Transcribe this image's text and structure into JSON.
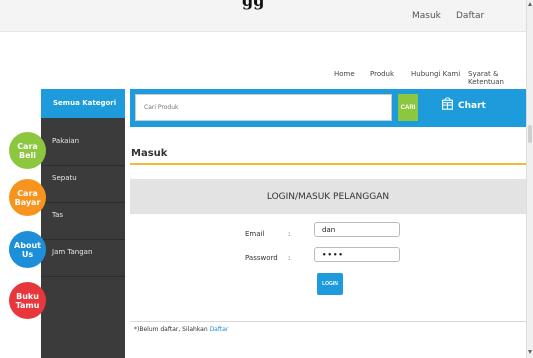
{
  "top_bar": {
    "logo_text": "gg",
    "masuk": "Masuk",
    "daftar": "Daftar"
  },
  "main_nav": {
    "home": "Home",
    "produk": "Produk",
    "hubungi": "Hubungi Kami",
    "syarat": "Syarat & Ketentuan"
  },
  "sidebar": {
    "header": "Semua Kategori",
    "items": [
      {
        "label": "Pakaian"
      },
      {
        "label": "Sepatu"
      },
      {
        "label": "Tas"
      },
      {
        "label": "Jam Tangan"
      }
    ]
  },
  "floating": {
    "cara_beli": [
      "Cara",
      "Beli"
    ],
    "cara_bayar": [
      "Cara",
      "Bayar"
    ],
    "about": [
      "About",
      "Us"
    ],
    "buku_tamu": [
      "Buku",
      "Tamu"
    ]
  },
  "search": {
    "placeholder": "Cari Produk",
    "button": "CARI",
    "cart_label": "Chart",
    "cart_icon": "shopping-cart-icon"
  },
  "page": {
    "section_title": "Masuk",
    "panel_title": "LOGIN/MASUK PELANGGAN"
  },
  "form": {
    "email_label": "Email",
    "password_label": "Password",
    "colon": ":",
    "email_value": "dan",
    "password_value": "••••",
    "login_button": "LOGIN"
  },
  "footer": {
    "note": "*)Belum daftar, Silahkan ",
    "link": "Daftar"
  },
  "colors": {
    "accent_blue": "#1d9bdb",
    "green": "#8dc63f",
    "orange": "#f7941d",
    "red": "#e8373c",
    "sidebar_dark": "#3b3b3b"
  }
}
